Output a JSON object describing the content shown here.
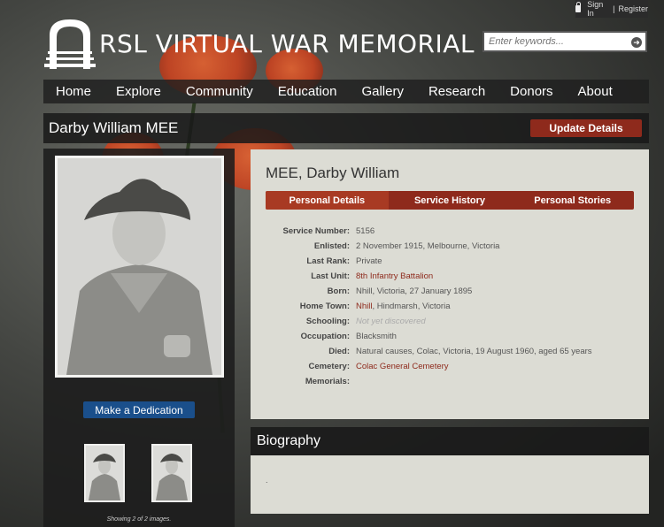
{
  "header": {
    "sign_in": "Sign In",
    "separator": "|",
    "register": "Register",
    "site_title": "RSL VIRTUAL WAR MEMORIAL"
  },
  "search": {
    "placeholder": "Enter keywords..."
  },
  "nav": {
    "items": [
      "Home",
      "Explore",
      "Community",
      "Education",
      "Gallery",
      "Research",
      "Donors",
      "About"
    ]
  },
  "profile": {
    "display_name": "Darby William MEE",
    "update_label": "Update Details",
    "heading": "MEE, Darby William",
    "tabs": [
      "Personal Details",
      "Service History",
      "Personal Stories"
    ]
  },
  "fields": [
    {
      "label": "Service Number:",
      "value": "5156"
    },
    {
      "label": "Enlisted:",
      "value": "2 November 1915, Melbourne, Victoria"
    },
    {
      "label": "Last Rank:",
      "value": "Private"
    },
    {
      "label": "Last Unit:",
      "value": "8th Infantry Battalion"
    },
    {
      "label": "Born:",
      "value": "Nhill, Victoria, 27 January 1895"
    },
    {
      "label": "Home Town:",
      "value_link": "Nhill",
      "value_rest": ", Hindmarsh, Victoria"
    },
    {
      "label": "Schooling:",
      "value": "Not yet discovered"
    },
    {
      "label": "Occupation:",
      "value": "Blacksmith"
    },
    {
      "label": "Died:",
      "value": "Natural causes, Colac, Victoria, 19 August 1960, aged 65 years"
    },
    {
      "label": "Cemetery:",
      "value": "Colac General Cemetery"
    },
    {
      "label": "Memorials:",
      "value": ""
    }
  ],
  "left": {
    "dedication_label": "Make a Dedication",
    "showing_text": "Showing 2 of 2 images."
  },
  "biography": {
    "heading": "Biography",
    "body": "."
  },
  "colors": {
    "accent": "#8e2a1c",
    "dedication": "#1a4f8b",
    "panel": "#dcdcd4"
  }
}
